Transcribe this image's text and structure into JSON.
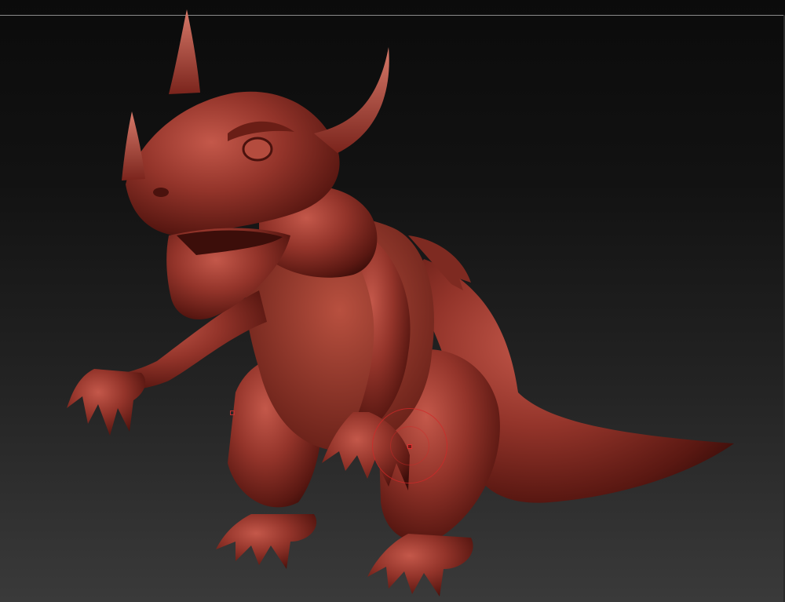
{
  "viewport": {
    "background_top": "#0b0b0b",
    "background_bottom": "#3a3a3a",
    "material_color": "#8a2a22",
    "material_highlight": "#c4584a",
    "material_shadow": "#3c0e0a"
  },
  "model": {
    "icon": "dragon-sculpt"
  },
  "brush": {
    "icon": "brush-ring-icon",
    "color": "#d22828"
  }
}
